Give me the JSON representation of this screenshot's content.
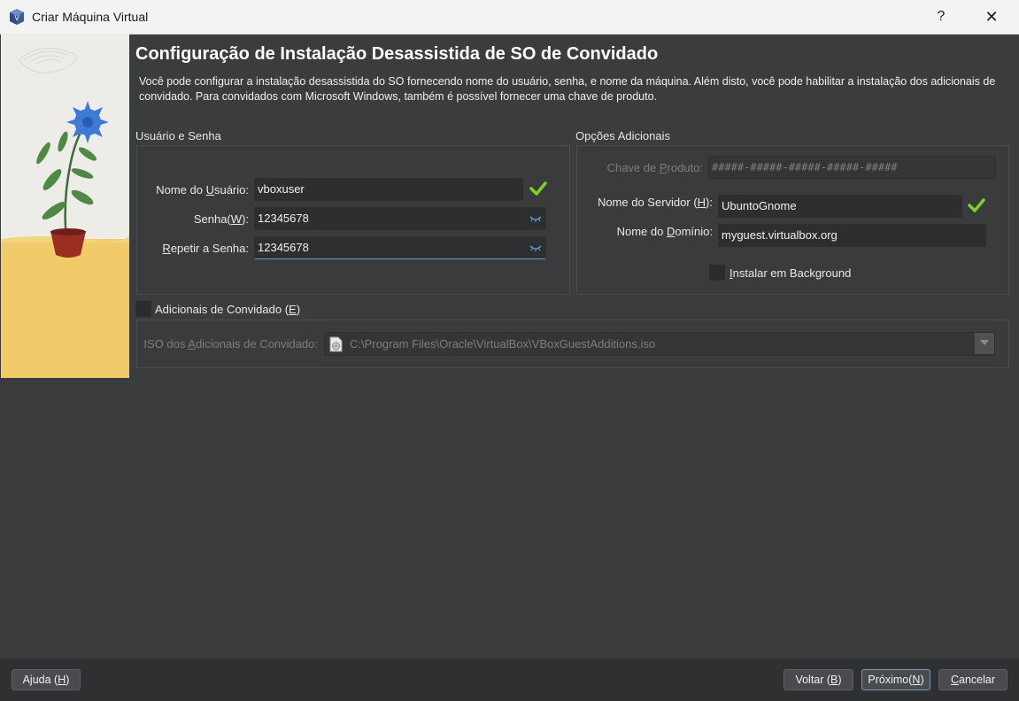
{
  "window": {
    "title": "Criar Máquina Virtual",
    "help_glyph": "?",
    "close_glyph": "✕"
  },
  "page": {
    "heading": "Configuração de Instalação Desassistida de SO de Convidado",
    "description": "Você pode configurar a instalação desassistida do SO fornecendo nome do usuário, senha, e nome da máquina. Além disto, você pode habilitar a instalação dos adicionais de convidado. Para convidados com Microsoft Windows, também é possível fornecer uma chave de produto."
  },
  "user_group": {
    "title": "Usuário e Senha",
    "username_label_pre": "Nome do ",
    "username_label_key": "U",
    "username_label_post": "suário:",
    "username_value": "vboxuser",
    "password_label_pre": "Senha(",
    "password_label_key": "W",
    "password_label_post": "):",
    "password_value": "12345678",
    "repeat_label_key": "R",
    "repeat_label_post": "epetir a Senha:",
    "repeat_value": "12345678"
  },
  "options_group": {
    "title": "Opções Adicionais",
    "product_key_label_pre": "Chave de ",
    "product_key_label_key": "P",
    "product_key_label_post": "roduto:",
    "product_key_placeholder": "#####-#####-#####-#####-#####",
    "hostname_label_pre": "Nome do Servidor (",
    "hostname_label_key": "H",
    "hostname_label_post": "):",
    "hostname_value": "UbuntoGnome",
    "domain_label_pre": "Nome do ",
    "domain_label_key": "D",
    "domain_label_post": "omínio:",
    "domain_value": "myguest.virtualbox.org",
    "background_key": "I",
    "background_post": "nstalar em Background",
    "background_checked": false
  },
  "guest_additions": {
    "label_pre": "Adicionais de Convidado (",
    "label_key": "E",
    "label_post": ")",
    "checked": false,
    "iso_label_pre": "ISO dos ",
    "iso_label_key": "A",
    "iso_label_post": "dicionais de Convidado:",
    "iso_path": "C:\\Program Files\\Oracle\\VirtualBox\\VBoxGuestAdditions.iso"
  },
  "footer": {
    "help_pre": "Ajuda (",
    "help_key": "H",
    "help_post": ")",
    "back_pre": "Voltar (",
    "back_key": "B",
    "back_post": ")",
    "next_pre": "Próximo(",
    "next_key": "N",
    "next_post": ")",
    "cancel_key": "C",
    "cancel_post": "ancelar"
  },
  "colors": {
    "background": "#3b3c3e",
    "field": "#2d2e30",
    "valid_check": "#7ed321",
    "focus_accent": "#5fa0d6"
  },
  "icons": [
    "virtualbox-app-icon",
    "help-icon",
    "close-icon",
    "valid-check-icon",
    "eye-icon",
    "iso-file-icon",
    "chevron-down-icon"
  ]
}
